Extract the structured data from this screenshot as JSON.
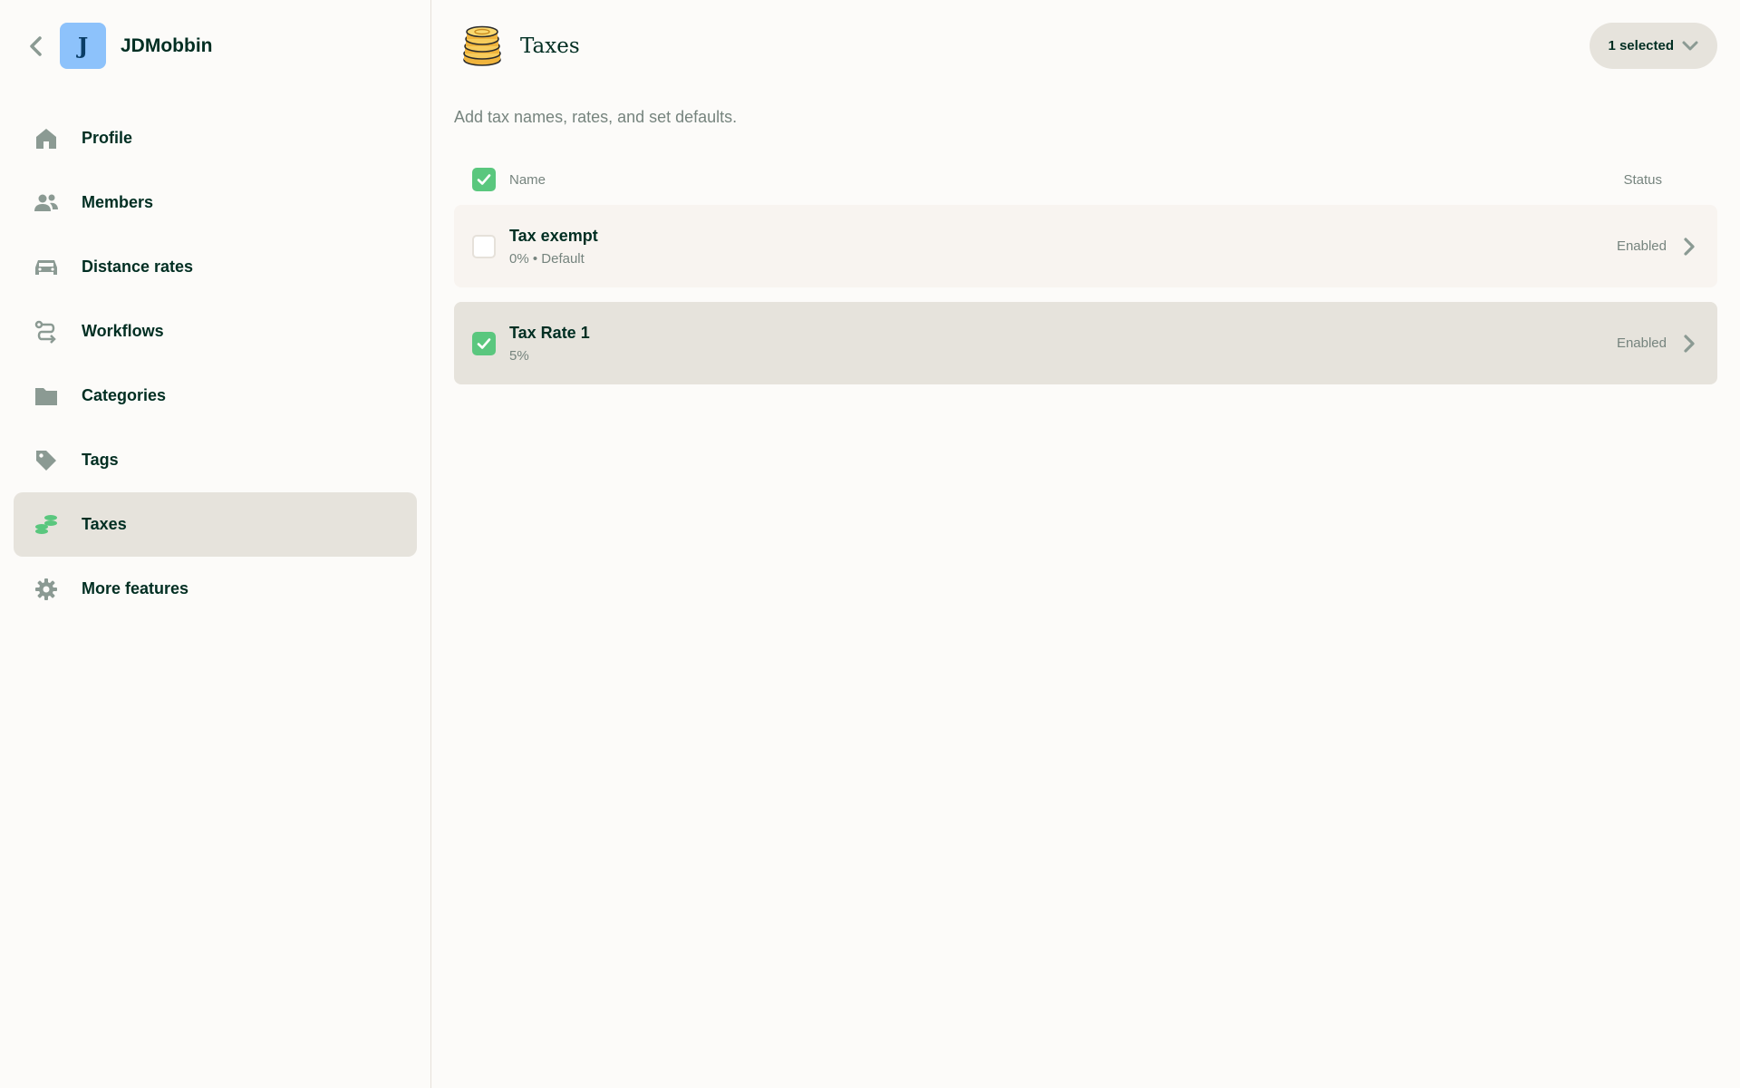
{
  "workspace": {
    "name": "JDMobbin",
    "avatar_letter": "J",
    "avatar_color": "#8dc2fb"
  },
  "sidebar": {
    "items": [
      {
        "label": "Profile",
        "icon": "home-icon",
        "active": false
      },
      {
        "label": "Members",
        "icon": "users-icon",
        "active": false
      },
      {
        "label": "Distance rates",
        "icon": "car-icon",
        "active": false
      },
      {
        "label": "Workflows",
        "icon": "workflow-icon",
        "active": false
      },
      {
        "label": "Categories",
        "icon": "folder-icon",
        "active": false
      },
      {
        "label": "Tags",
        "icon": "tag-icon",
        "active": false
      },
      {
        "label": "Taxes",
        "icon": "coins-icon",
        "active": true
      },
      {
        "label": "More features",
        "icon": "gear-icon",
        "active": false
      }
    ]
  },
  "header": {
    "title": "Taxes",
    "icon": "coins-stack-icon",
    "selection_label": "1 selected"
  },
  "subtitle": "Add tax names, rates, and set defaults.",
  "table": {
    "columns": {
      "name": "Name",
      "status": "Status"
    },
    "rows": [
      {
        "title": "Tax exempt",
        "subtitle": "0% • Default",
        "status": "Enabled",
        "checked": false
      },
      {
        "title": "Tax Rate 1",
        "subtitle": "5%",
        "status": "Enabled",
        "checked": true
      }
    ]
  },
  "colors": {
    "accent_green": "#5ac77e",
    "text_primary": "#002e22",
    "text_secondary": "#76847e",
    "active_bg": "#e6e3dc",
    "page_bg": "#fcfbf9"
  }
}
